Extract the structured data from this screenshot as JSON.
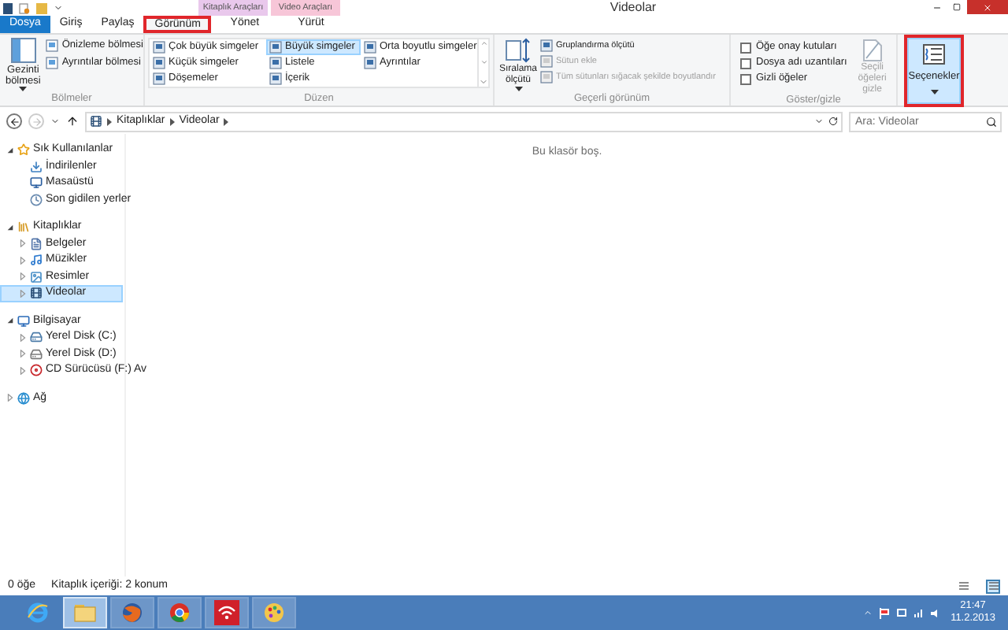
{
  "title_bar": {
    "title": "Videolar"
  },
  "context_groups": [
    {
      "label": "Kitaplık Araçları",
      "color": "#e9c8ec"
    },
    {
      "label": "Video Araçları",
      "color": "#f7c6d8"
    }
  ],
  "ribbon_tabs": [
    {
      "label": "Dosya",
      "kind": "file",
      "selected": false,
      "highlighted": false
    },
    {
      "label": "Giriş",
      "kind": "tab",
      "selected": false,
      "highlighted": false
    },
    {
      "label": "Paylaş",
      "kind": "tab",
      "selected": false,
      "highlighted": false
    },
    {
      "label": "Görünüm",
      "kind": "tab",
      "selected": true,
      "highlighted": true
    },
    {
      "label": "Yönet",
      "kind": "context",
      "selected": false,
      "highlighted": false
    },
    {
      "label": "Yürüt",
      "kind": "context",
      "selected": false,
      "highlighted": false
    }
  ],
  "panes_group": {
    "label": "Bölmeler",
    "large_button": {
      "label": "Gezinti bölmesi"
    },
    "buttons": [
      {
        "label": "Önizleme bölmesi"
      },
      {
        "label": "Ayrıntılar bölmesi"
      }
    ]
  },
  "layout_group": {
    "label": "Düzen",
    "options": [
      {
        "label": "Çok büyük simgeler",
        "selected": false
      },
      {
        "label": "Küçük simgeler",
        "selected": false
      },
      {
        "label": "Döşemeler",
        "selected": false
      },
      {
        "label": "Büyük simgeler",
        "selected": true
      },
      {
        "label": "Listele",
        "selected": false
      },
      {
        "label": "İçerik",
        "selected": false
      },
      {
        "label": "Orta boyutlu simgeler",
        "selected": false
      },
      {
        "label": "Ayrıntılar",
        "selected": false
      }
    ]
  },
  "current_view_group": {
    "label": "Geçerli görünüm",
    "sort_button": {
      "label": "Sıralama ölçütü"
    },
    "buttons": [
      {
        "label": "Gruplandırma ölçütü",
        "disabled": false
      },
      {
        "label": "Sütun ekle",
        "disabled": true
      },
      {
        "label": "Tüm sütunları sığacak şekilde boyutlandır",
        "disabled": true
      }
    ]
  },
  "show_hide_group": {
    "label": "Göster/gizle",
    "checkboxes": [
      {
        "label": "Öğe onay kutuları",
        "checked": false
      },
      {
        "label": "Dosya adı uzantıları",
        "checked": false
      },
      {
        "label": "Gizli öğeler",
        "checked": false
      }
    ],
    "hide_button": {
      "label": "Seçili öğeleri gizle",
      "disabled": true
    }
  },
  "options_button": {
    "label": "Seçenekler",
    "highlighted": true
  },
  "address_bar": {
    "path": [
      "Kitaplıklar",
      "Videolar"
    ]
  },
  "search": {
    "placeholder": "Ara: Videolar"
  },
  "navigation": [
    {
      "label": "Sık Kullanılanlar",
      "expanded": true,
      "selected": false,
      "children": [
        {
          "label": "İndirilenler",
          "selected": false
        },
        {
          "label": "Masaüstü",
          "selected": false
        },
        {
          "label": "Son gidilen yerler",
          "selected": false
        }
      ]
    },
    {
      "label": "Kitaplıklar",
      "expanded": true,
      "selected": false,
      "children": [
        {
          "label": "Belgeler",
          "expanded": false,
          "selected": false
        },
        {
          "label": "Müzikler",
          "expanded": false,
          "selected": false
        },
        {
          "label": "Resimler",
          "expanded": false,
          "selected": false
        },
        {
          "label": "Videolar",
          "expanded": false,
          "selected": true
        }
      ]
    },
    {
      "label": "Bilgisayar",
      "expanded": true,
      "selected": false,
      "children": [
        {
          "label": "Yerel Disk (C:)",
          "expanded": false,
          "selected": false
        },
        {
          "label": "Yerel Disk (D:)",
          "expanded": false,
          "selected": false
        },
        {
          "label": "CD Sürücüsü (F:) Av",
          "expanded": false,
          "selected": false
        }
      ]
    },
    {
      "label": "Ağ",
      "expanded": false,
      "selected": false
    }
  ],
  "content": {
    "empty_message": "Bu klasör boş."
  },
  "status_bar": {
    "item_count": "0 öğe",
    "library_info": "Kitaplık içeriği: 2 konum",
    "views": [
      {
        "selected": false
      },
      {
        "selected": true
      }
    ]
  },
  "taskbar": {
    "apps": [
      {
        "selected": false
      },
      {
        "selected": true
      },
      {
        "selected": false
      },
      {
        "selected": false
      },
      {
        "selected": false
      },
      {
        "selected": false
      }
    ],
    "time": "21:47",
    "date": "11.2.2013"
  }
}
